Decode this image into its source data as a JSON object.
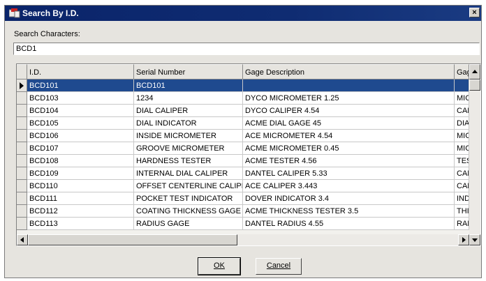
{
  "window": {
    "title": "Search By I.D.",
    "close_glyph": "×"
  },
  "search": {
    "label": "Search Characters:",
    "value": "BCD1"
  },
  "grid": {
    "columns": [
      "I.D.",
      "Serial Number",
      "Gage Description",
      "Gage"
    ],
    "rows": [
      [
        "BCD101",
        "BCD101",
        "",
        ""
      ],
      [
        "BCD103",
        "1234",
        "DYCO MICROMETER 1.25",
        "MICR"
      ],
      [
        "BCD104",
        "DIAL CALIPER",
        "DYCO CALIPER 4.54",
        "CALI"
      ],
      [
        "BCD105",
        "DIAL INDICATOR",
        "ACME DIAL GAGE 45",
        "DIAL"
      ],
      [
        "BCD106",
        "INSIDE MICROMETER",
        "ACE MICROMETER 4.54",
        "MICR"
      ],
      [
        "BCD107",
        "GROOVE MICROMETER",
        "ACME MICROMETER 0.45",
        "MICR"
      ],
      [
        "BCD108",
        "HARDNESS TESTER",
        "ACME TESTER 4.56",
        "TEST"
      ],
      [
        "BCD109",
        "INTERNAL DIAL CALIPER",
        "DANTEL CALIPER 5.33",
        "CALI"
      ],
      [
        "BCD110",
        "OFFSET CENTERLINE CALIPER",
        "ACE CALIPER 3.443",
        "CALI"
      ],
      [
        "BCD111",
        "POCKET TEST INDICATOR",
        "DOVER INDICATOR 3.4",
        "INDIC"
      ],
      [
        "BCD112",
        "COATING THICKNESS GAGE",
        "ACME THICKNESS TESTER 3.5",
        "THIC"
      ],
      [
        "BCD113",
        "RADIUS GAGE",
        "DANTEL RADIUS 4.55",
        "RAD"
      ]
    ],
    "selected_row": 0
  },
  "buttons": {
    "ok": "OK",
    "cancel": "Cancel"
  },
  "colors": {
    "titlebar": "#0a246a",
    "selection": "#1f4a8f",
    "face": "#e6e4df"
  }
}
